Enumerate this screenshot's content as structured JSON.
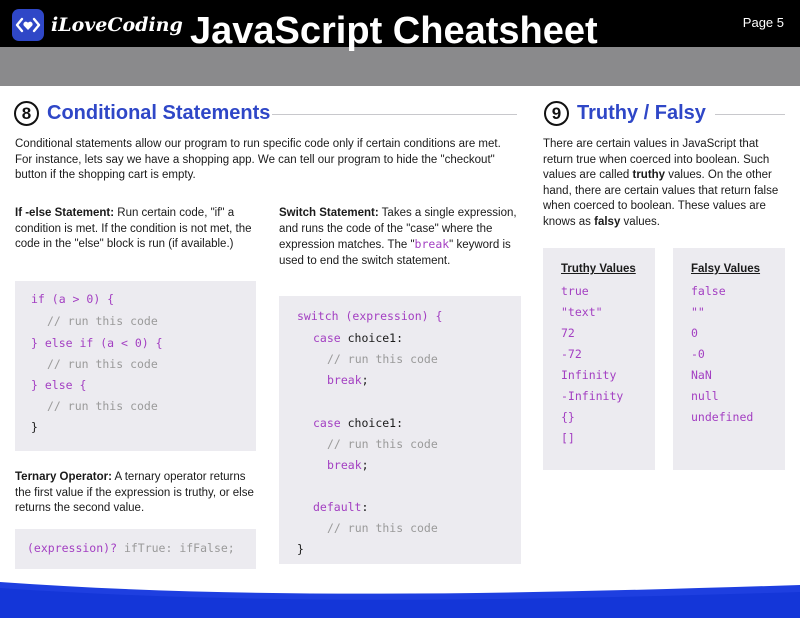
{
  "header": {
    "brand": "iLoveCoding",
    "title": "JavaScript Cheatsheet",
    "page": "Page 5"
  },
  "conditional": {
    "number": "8",
    "title": "Conditional Statements",
    "intro": "Conditional statements allow our program to run specific code only if certain conditions are met. For instance, lets say we have a shopping app. We can tell our program to hide the \"checkout\" button if the shopping cart is empty.",
    "ifelse": {
      "heading": "If -else Statement:",
      "text": " Run certain code, \"if\" a condition is met. If the condition is not met, the code in the \"else\" block is run (if available.)",
      "code": {
        "l1_kw": "if",
        "l1_rest": " (a > 0) {",
        "l2": "// run this code",
        "l3_a": "} ",
        "l3_kw": "else if",
        "l3_rest": " (a < 0) {",
        "l4": "// run this code",
        "l5_a": "} ",
        "l5_kw": "else",
        "l5_rest": " {",
        "l6": "// run this code",
        "l7": "}"
      }
    },
    "ternary": {
      "heading": "Ternary Operator:",
      "text": " A ternary operator returns the first value if the expression is truthy, or else returns the second value.",
      "code_expr": "(expression)? ",
      "code_rest": "ifTrue: ifFalse;"
    },
    "switch": {
      "heading": "Switch Statement:",
      "text_a": " Takes a single expression, and runs the code of the \"case\" where the expression matches. The \"",
      "text_break": "break",
      "text_b": "\" keyword is used to end the switch statement.",
      "code": {
        "l1_kw": "switch",
        "l1_rest": " (expression) {",
        "case_kw": "case",
        "case1": " choice1:",
        "cm1": "// run this code",
        "break_kw": "break",
        "break_end": ";",
        "case2": " choice1:",
        "cm2": "// run this code",
        "default_kw": "default",
        "default_end": ":",
        "cm3": "// run this code",
        "close": "}"
      }
    }
  },
  "truthy": {
    "number": "9",
    "title": "Truthy / Falsy",
    "intro_a": "There are certain values in JavaScript that return true when coerced into boolean. Such values are called ",
    "intro_truthy": "truthy",
    "intro_b": " values. On the other hand, there are certain values that return false when coerced to boolean. These values are knows as ",
    "intro_falsy": "falsy",
    "intro_c": " values.",
    "truthy_header": "Truthy Values",
    "truthy_values": [
      "true",
      "\"text\"",
      "72",
      "-72",
      "Infinity",
      "-Infinity",
      "{}",
      "[]"
    ],
    "falsy_header": "Falsy Values",
    "falsy_values": [
      "false",
      "\"\"",
      "0",
      "-0",
      "NaN",
      "null",
      "undefined"
    ]
  },
  "colors": {
    "accent": "#2f47c7",
    "keyword": "#a33fc2",
    "comment": "#9a9a9a",
    "code_bg": "#ecebf0"
  }
}
